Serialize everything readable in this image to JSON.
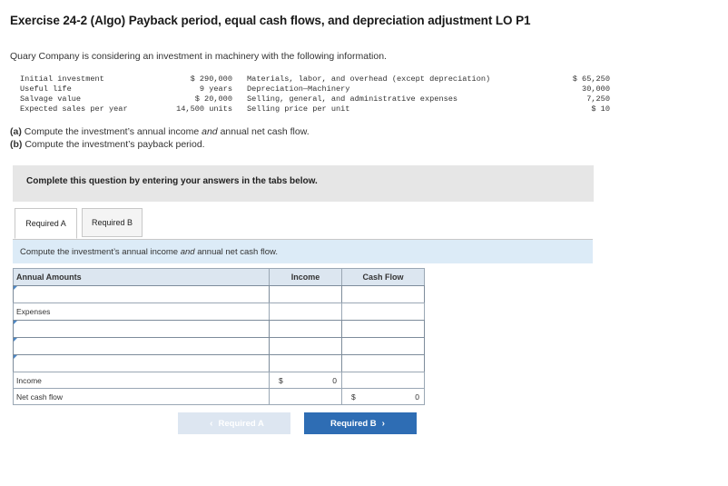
{
  "header": {
    "title": "Exercise 24-2 (Algo) Payback period, equal cash flows, and depreciation adjustment LO P1",
    "intro": "Quary Company is considering an investment in machinery with the following information."
  },
  "info_rows": [
    {
      "label": "Initial investment",
      "value": "$ 290,000",
      "label2": "Materials, labor, and overhead (except depreciation)",
      "value2": "$ 65,250"
    },
    {
      "label": "Useful life",
      "value": "9 years",
      "label2": "Depreciation—Machinery",
      "value2": "30,000"
    },
    {
      "label": "Salvage value",
      "value": "$ 20,000",
      "label2": "Selling, general, and administrative expenses",
      "value2": "7,250"
    },
    {
      "label": "Expected sales per year",
      "value": "14,500 units",
      "label2": "Selling price per unit",
      "value2": "$ 10"
    }
  ],
  "questions": {
    "a_tag": "(a)",
    "a_text_1": "Compute the investment’s annual income",
    "a_and": "and",
    "a_text_2": "annual net cash flow.",
    "b_tag": "(b)",
    "b_text": "Compute the investment’s payback period."
  },
  "instruction": "Complete this question by entering your answers in the tabs below.",
  "tabs": [
    {
      "label": "Required A",
      "active": true
    },
    {
      "label": "Required B",
      "active": false
    }
  ],
  "prompt": {
    "text_1": "Compute the investment’s annual income",
    "and": "and",
    "text_2": "annual net cash flow."
  },
  "table": {
    "headers": {
      "col1": "Annual Amounts",
      "col2": "Income",
      "col3": "Cash Flow"
    },
    "rows": [
      {
        "label": "",
        "income": "",
        "cash": "",
        "type": "input"
      },
      {
        "label": "Expenses",
        "income": "",
        "cash": "",
        "type": "label"
      },
      {
        "label": "",
        "income": "",
        "cash": "",
        "type": "input"
      },
      {
        "label": "",
        "income": "",
        "cash": "",
        "type": "input"
      },
      {
        "label": "Income",
        "income_prefix": "$",
        "income": "0",
        "cash": "",
        "type": "label"
      },
      {
        "label": "Net cash flow",
        "income": "",
        "cash_prefix": "$",
        "cash": "0",
        "type": "label"
      }
    ]
  },
  "nav": {
    "prev_label": "Required A",
    "next_label": "Required B",
    "prev_icon": "chevron-left-icon",
    "next_icon": "chevron-right-icon"
  },
  "colors": {
    "accent": "#2e6db4",
    "prompt_bg": "#dcebf7",
    "header_bg": "#dce6f0",
    "instruction_bg": "#e6e6e6"
  }
}
